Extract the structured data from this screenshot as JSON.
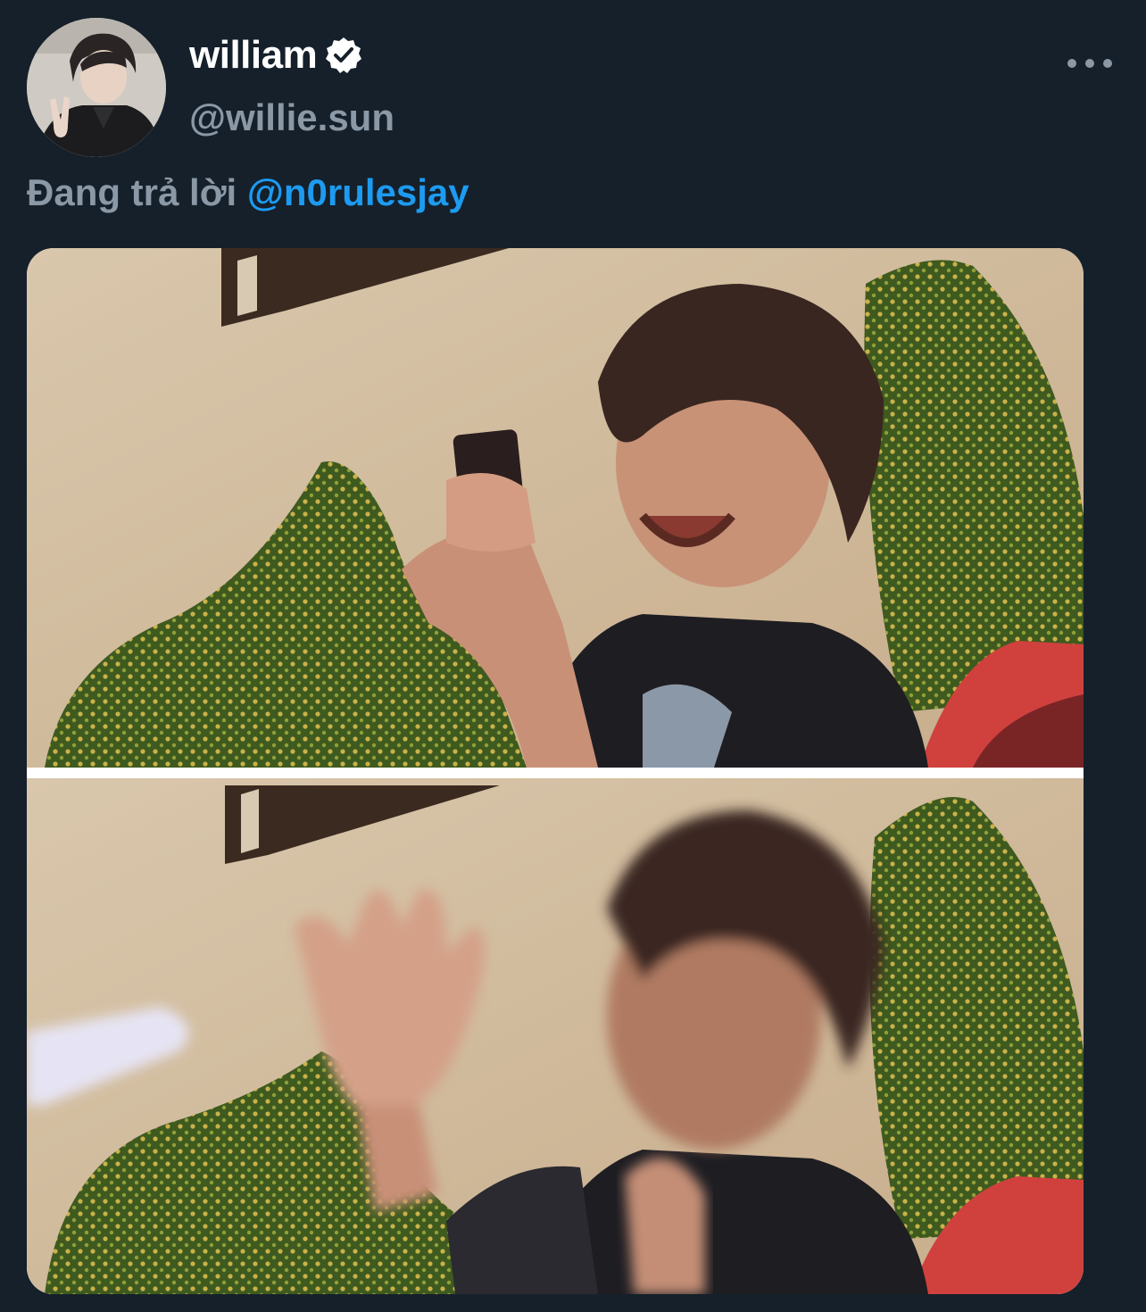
{
  "author": {
    "display_name": "william",
    "handle": "@willie.sun",
    "verified": true,
    "avatar_icon": "profile-photo"
  },
  "reply": {
    "prefix": "Đang trả lời",
    "mention": "@n0rulesjay"
  },
  "more_icon": "more-horizontal-icon",
  "media": {
    "type": "image",
    "panels": 2
  },
  "colors": {
    "background": "#15202b",
    "text_primary": "#ffffff",
    "text_secondary": "#8b98a5",
    "link": "#1d9bf0"
  }
}
